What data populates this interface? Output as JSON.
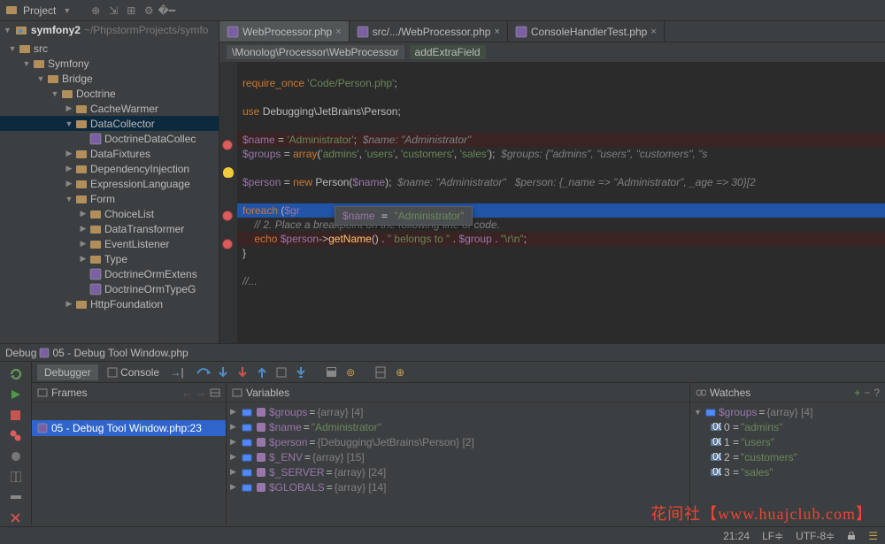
{
  "top": {
    "project_label": "Project",
    "project_path": "~/PhpstormProjects/symfo"
  },
  "tree": {
    "root": "symfony2",
    "nodes": [
      {
        "d": 0,
        "open": true,
        "label": "src",
        "type": "folder"
      },
      {
        "d": 1,
        "open": true,
        "label": "Symfony",
        "type": "folder"
      },
      {
        "d": 2,
        "open": true,
        "label": "Bridge",
        "type": "folder"
      },
      {
        "d": 3,
        "open": true,
        "label": "Doctrine",
        "type": "folder"
      },
      {
        "d": 4,
        "open": false,
        "label": "CacheWarmer",
        "type": "folder"
      },
      {
        "d": 4,
        "open": true,
        "label": "DataCollector",
        "type": "folder",
        "sel": true
      },
      {
        "d": 5,
        "open": null,
        "label": "DoctrineDataCollec",
        "type": "php"
      },
      {
        "d": 4,
        "open": false,
        "label": "DataFixtures",
        "type": "folder"
      },
      {
        "d": 4,
        "open": false,
        "label": "DependencyInjection",
        "type": "folder"
      },
      {
        "d": 4,
        "open": false,
        "label": "ExpressionLanguage",
        "type": "folder"
      },
      {
        "d": 4,
        "open": true,
        "label": "Form",
        "type": "folder"
      },
      {
        "d": 5,
        "open": false,
        "label": "ChoiceList",
        "type": "folder"
      },
      {
        "d": 5,
        "open": false,
        "label": "DataTransformer",
        "type": "folder"
      },
      {
        "d": 5,
        "open": false,
        "label": "EventListener",
        "type": "folder"
      },
      {
        "d": 5,
        "open": false,
        "label": "Type",
        "type": "folder"
      },
      {
        "d": 5,
        "open": null,
        "label": "DoctrineOrmExtens",
        "type": "php"
      },
      {
        "d": 5,
        "open": null,
        "label": "DoctrineOrmTypeG",
        "type": "php"
      },
      {
        "d": 4,
        "open": false,
        "label": "HttpFoundation",
        "type": "folder"
      }
    ]
  },
  "tabs": [
    {
      "label": "WebProcessor.php",
      "active": true
    },
    {
      "label": "src/.../WebProcessor.php",
      "active": false
    },
    {
      "label": "ConsoleHandlerTest.php",
      "active": false
    }
  ],
  "crumbs": [
    "\\Monolog\\Processor\\WebProcessor",
    "addExtraField"
  ],
  "code": {
    "lines": [
      {
        "t": "blank"
      },
      {
        "t": "req",
        "kw": "require_once",
        "str": "'Code/Person.php'"
      },
      {
        "t": "blank"
      },
      {
        "t": "use",
        "kw": "use",
        "path": "Debugging\\JetBrains\\Person"
      },
      {
        "t": "blank"
      },
      {
        "t": "assign",
        "bp": true,
        "var": "$name",
        "val": "'Administrator'",
        "hint": "$name: \"Administrator\""
      },
      {
        "t": "arr",
        "var": "$groups",
        "kw": "array",
        "items": [
          "'admins'",
          "'users'",
          "'customers'",
          "'sales'"
        ],
        "hint": "$groups: {\"admins\", \"users\", \"customers\", \"s"
      },
      {
        "t": "blank",
        "bulb": true
      },
      {
        "t": "new",
        "var": "$person",
        "kw": "new",
        "cls": "Person",
        "arg": "$name",
        "hint": "$name: \"Administrator\"   $person: {_name => \"Administrator\", _age => 30}[2"
      },
      {
        "t": "blank"
      },
      {
        "t": "foreach",
        "bp": true,
        "exec": true,
        "kw": "foreach",
        "expr": "$gr"
      },
      {
        "t": "comment",
        "txt": "// 2. Place a breakpoint on the following line of code."
      },
      {
        "t": "echo",
        "bp": true,
        "kw": "echo",
        "expr": "$person->getName() . \" belongs to \" . $group . \"\\r\\n\";"
      },
      {
        "t": "close",
        "txt": "}"
      },
      {
        "t": "blank"
      },
      {
        "t": "fold",
        "txt": "//..."
      }
    ],
    "tooltip": {
      "var": "$name",
      "val": "\"Administrator\""
    }
  },
  "debug": {
    "title": "Debug",
    "session": "05 - Debug Tool Window.php",
    "tabs": {
      "debugger": "Debugger",
      "console": "Console"
    },
    "frames": {
      "title": "Frames",
      "active": "05 - Debug Tool Window.php:23"
    },
    "variables": {
      "title": "Variables",
      "rows": [
        {
          "name": "$groups",
          "val": "{array} [4]"
        },
        {
          "name": "$name",
          "val": "\"Administrator\"",
          "str": true
        },
        {
          "name": "$person",
          "val": "{Debugging\\JetBrains\\Person} [2]"
        },
        {
          "name": "$_ENV",
          "val": "{array} [15]"
        },
        {
          "name": "$_SERVER",
          "val": "{array} [24]"
        },
        {
          "name": "$GLOBALS",
          "val": "{array} [14]"
        }
      ]
    },
    "watches": {
      "title": "Watches",
      "root": {
        "name": "$groups",
        "val": "{array} [4]"
      },
      "items": [
        {
          "k": "0",
          "v": "\"admins\""
        },
        {
          "k": "1",
          "v": "\"users\""
        },
        {
          "k": "2",
          "v": "\"customers\""
        },
        {
          "k": "3",
          "v": "\"sales\""
        }
      ]
    }
  },
  "status": {
    "pos": "21:24",
    "sep": "LF",
    "enc": "UTF-8"
  },
  "watermark": "花间社【www.huajclub.com】"
}
